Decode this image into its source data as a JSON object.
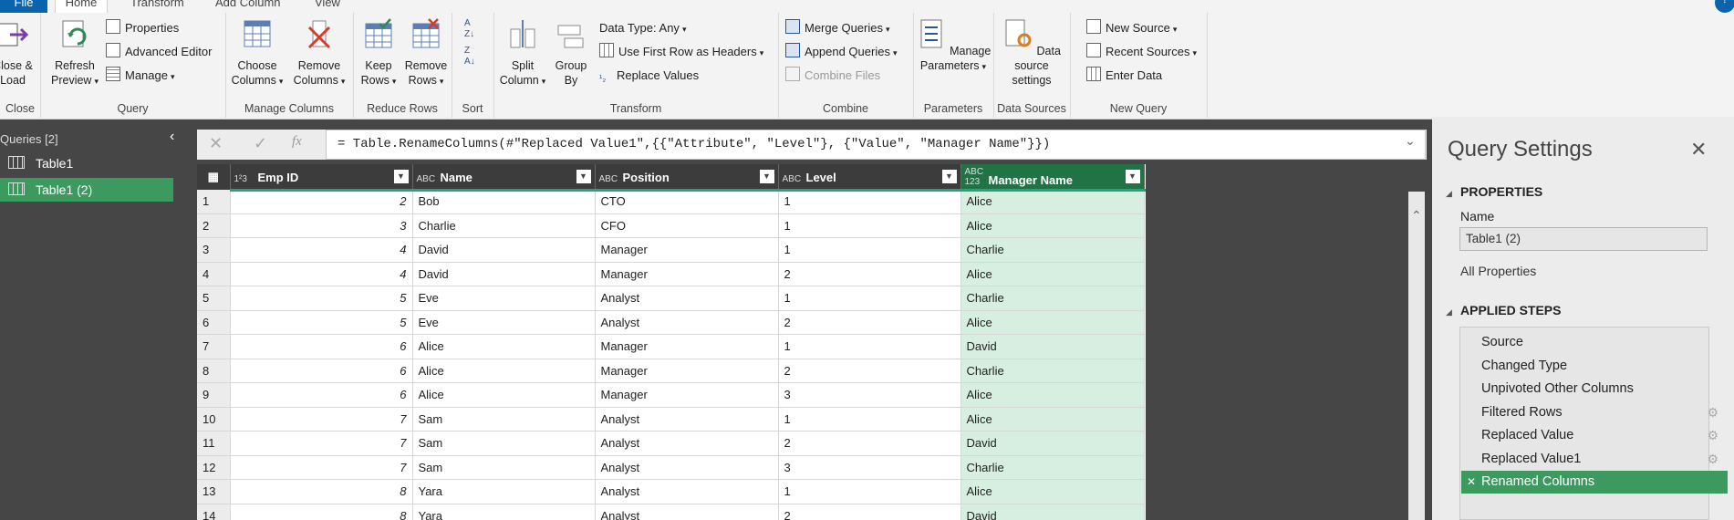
{
  "tabs": {
    "file": "File",
    "home": "Home",
    "transform": "Transform",
    "add_column": "Add Column",
    "view": "View"
  },
  "ribbon": {
    "close": {
      "btn": "Close & Load",
      "label": "Close"
    },
    "query": {
      "refresh": "Refresh Preview",
      "properties": "Properties",
      "advanced_editor": "Advanced Editor",
      "manage": "Manage",
      "label": "Query"
    },
    "manage_columns": {
      "choose": "Choose Columns",
      "remove": "Remove Columns",
      "label": "Manage Columns"
    },
    "reduce_rows": {
      "keep": "Keep Rows",
      "remove": "Remove Rows",
      "label": "Reduce Rows"
    },
    "sort": {
      "label": "Sort"
    },
    "transform": {
      "split": "Split Column",
      "group": "Group By",
      "data_type": "Data Type: Any",
      "first_row": "Use First Row as Headers",
      "replace": "Replace Values",
      "label": "Transform"
    },
    "combine": {
      "merge": "Merge Queries",
      "append": "Append Queries",
      "combine_files": "Combine Files",
      "label": "Combine"
    },
    "parameters": {
      "manage": "Manage Parameters",
      "label": "Parameters"
    },
    "data_sources": {
      "settings": "Data source settings",
      "label": "Data Sources"
    },
    "new_query": {
      "new_source": "New Source",
      "recent": "Recent Sources",
      "enter": "Enter Data",
      "label": "New Query"
    }
  },
  "queries": {
    "title": "Queries [2]",
    "items": [
      "Table1",
      "Table1 (2)"
    ],
    "selected_index": 1
  },
  "formula": "= Table.RenameColumns(#\"Replaced Value1\",{{\"Attribute\", \"Level\"}, {\"Value\", \"Manager Name\"}})",
  "grid": {
    "columns": [
      {
        "type": "1²3",
        "name": "Emp ID"
      },
      {
        "type": "ABC",
        "name": "Name"
      },
      {
        "type": "ABC",
        "name": "Position"
      },
      {
        "type": "ABC",
        "name": "Level"
      },
      {
        "type": "ABC 123",
        "name": "Manager Name"
      }
    ],
    "rows": [
      [
        "1",
        "2",
        "Bob",
        "CTO",
        "1",
        "Alice"
      ],
      [
        "2",
        "3",
        "Charlie",
        "CFO",
        "1",
        "Alice"
      ],
      [
        "3",
        "4",
        "David",
        "Manager",
        "1",
        "Charlie"
      ],
      [
        "4",
        "4",
        "David",
        "Manager",
        "2",
        "Alice"
      ],
      [
        "5",
        "5",
        "Eve",
        "Analyst",
        "1",
        "Charlie"
      ],
      [
        "6",
        "5",
        "Eve",
        "Analyst",
        "2",
        "Alice"
      ],
      [
        "7",
        "6",
        "Alice",
        "Manager",
        "1",
        "David"
      ],
      [
        "8",
        "6",
        "Alice",
        "Manager",
        "2",
        "Charlie"
      ],
      [
        "9",
        "6",
        "Alice",
        "Manager",
        "3",
        "Alice"
      ],
      [
        "10",
        "7",
        "Sam",
        "Analyst",
        "1",
        "Alice"
      ],
      [
        "11",
        "7",
        "Sam",
        "Analyst",
        "2",
        "David"
      ],
      [
        "12",
        "7",
        "Sam",
        "Analyst",
        "3",
        "Charlie"
      ],
      [
        "13",
        "8",
        "Yara",
        "Analyst",
        "1",
        "Alice"
      ],
      [
        "14",
        "8",
        "Yara",
        "Analyst",
        "2",
        "David"
      ]
    ]
  },
  "settings": {
    "title": "Query Settings",
    "properties": "PROPERTIES",
    "name_label": "Name",
    "name_value": "Table1 (2)",
    "all_properties": "All Properties",
    "applied_steps": "APPLIED STEPS",
    "steps": [
      "Source",
      "Changed Type",
      "Unpivoted Other Columns",
      "Filtered Rows",
      "Replaced Value",
      "Replaced Value1",
      "Renamed Columns"
    ]
  }
}
